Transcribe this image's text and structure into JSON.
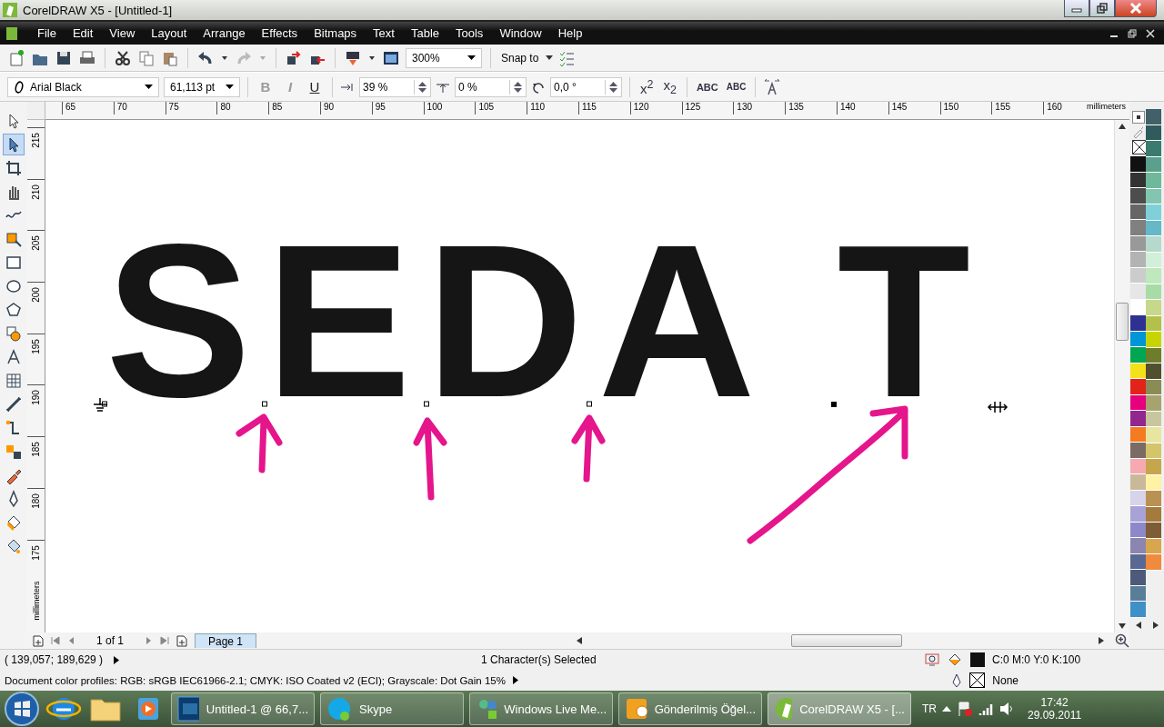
{
  "window": {
    "title": "CorelDRAW X5 - [Untitled-1]"
  },
  "menu": [
    "File",
    "Edit",
    "View",
    "Layout",
    "Arrange",
    "Effects",
    "Bitmaps",
    "Text",
    "Table",
    "Tools",
    "Window",
    "Help"
  ],
  "standard_toolbar": {
    "zoom": "300%",
    "snap": "Snap to"
  },
  "property_bar": {
    "font": "Arial Black",
    "size": "61,113 pt",
    "format_buttons": [
      {
        "label": "B",
        "disabled": true
      },
      {
        "label": "I",
        "disabled": true
      },
      {
        "label": "U",
        "disabled": false
      }
    ],
    "spinners": [
      "39 %",
      "0 %",
      "0,0 °"
    ],
    "script_buttons": [
      "x$^{2}$",
      "x$_{2}$"
    ],
    "case_buttons": [
      "ABC",
      "ABC"
    ]
  },
  "toolbox": [
    {
      "selected": false
    },
    {
      "selected": true
    },
    {
      "selected": false
    },
    {
      "selected": false
    },
    {
      "selected": false
    },
    {
      "selected": false
    },
    {
      "selected": false
    },
    {
      "selected": false
    },
    {
      "selected": false
    },
    {
      "selected": false
    },
    {
      "selected": false
    },
    {
      "selected": false
    },
    {
      "selected": false
    },
    {
      "selected": false
    },
    {
      "selected": false
    },
    {
      "selected": false
    },
    {
      "selected": false
    },
    {
      "selected": false
    },
    {
      "selected": false
    }
  ],
  "ruler_top": {
    "labels": [
      "65",
      "70",
      "75",
      "80",
      "85",
      "90",
      "95",
      "100",
      "105",
      "110",
      "115",
      "120",
      "125",
      "130",
      "135",
      "140",
      "145",
      "150",
      "155",
      "160"
    ],
    "unit": "millimeters"
  },
  "ruler_left": {
    "labels": [
      "215",
      "210",
      "205",
      "200",
      "195",
      "190",
      "185",
      "180",
      "175"
    ],
    "unit": "millimeters"
  },
  "canvas": {
    "text": "SEDA T"
  },
  "palette_columns": [
    [
      {
        "color": "#111111"
      },
      {
        "color": "#333333"
      },
      {
        "color": "#4d4d4d"
      },
      {
        "color": "#666666"
      },
      {
        "color": "#808080"
      },
      {
        "color": "#999999"
      },
      {
        "color": "#b3b3b3"
      },
      {
        "color": "#cccccc"
      },
      {
        "color": "#e6e6e6"
      },
      {
        "color": "#ffffff"
      },
      {
        "color": "#2e3192"
      },
      {
        "color": "#0095d9"
      },
      {
        "color": "#00a651"
      },
      {
        "color": "#f5e11a"
      },
      {
        "color": "#e2231a"
      },
      {
        "color": "#e6007e"
      },
      {
        "color": "#92278f"
      },
      {
        "color": "#f47b20"
      },
      {
        "color": "#7a6c64"
      },
      {
        "color": "#f6a9b0"
      },
      {
        "color": "#c9b99a"
      },
      {
        "color": "#d7d3ea"
      },
      {
        "color": "#a8a3d6"
      },
      {
        "color": "#8d89c9"
      },
      {
        "color": "#8a86b0"
      },
      {
        "color": "#5a6993"
      },
      {
        "color": "#4d5a7a"
      },
      {
        "color": "#5a7e9a"
      },
      {
        "color": "#3e90c6"
      }
    ],
    [
      {
        "color": "#41606a"
      },
      {
        "color": "#2f5b5c"
      },
      {
        "color": "#3b7a6f"
      },
      {
        "color": "#5ba08c"
      },
      {
        "color": "#6eb99b"
      },
      {
        "color": "#82c5b0"
      },
      {
        "color": "#7fd0d8"
      },
      {
        "color": "#64b8c8"
      },
      {
        "color": "#b5d9cc"
      },
      {
        "color": "#d2efd9"
      },
      {
        "color": "#bfe8bf"
      },
      {
        "color": "#a8dca6"
      },
      {
        "color": "#c8d88a"
      },
      {
        "color": "#b3c04a"
      },
      {
        "color": "#c8d400"
      },
      {
        "color": "#6d7d2b"
      },
      {
        "color": "#50502f"
      },
      {
        "color": "#8a8c56"
      },
      {
        "color": "#a6a36f"
      },
      {
        "color": "#c8c69f"
      },
      {
        "color": "#e8e5a3"
      },
      {
        "color": "#d4c46a"
      },
      {
        "color": "#c6a64c"
      },
      {
        "color": "#fff2a5"
      },
      {
        "color": "#b99152"
      },
      {
        "color": "#a47a3d"
      },
      {
        "color": "#7d5d37"
      },
      {
        "color": "#d9a64e"
      },
      {
        "color": "#f08a3c"
      }
    ]
  ],
  "page_nav": {
    "count": "1 of 1",
    "pages": [
      {
        "label": "Page 1",
        "selected": true
      }
    ]
  },
  "status_bar": {
    "coordinates": "( 139,057; 189,629 )",
    "selection": "1 Character(s) Selected",
    "profiles": "Document color profiles: RGB: sRGB IEC61966-2.1; CMYK: ISO Coated v2 (ECI); Grayscale: Dot Gain 15%",
    "fill": {
      "color": "#111111",
      "label": "C:0 M:0 Y:0 K:100"
    },
    "outline": {
      "label": "None"
    }
  },
  "taskbar": {
    "tasks": [
      {
        "label": "Untitled-1 @ 66,7...",
        "kind": "photoshop",
        "selected": false
      },
      {
        "label": "Skype",
        "kind": "skype",
        "selected": false
      },
      {
        "label": "Windows Live Me...",
        "kind": "messenger",
        "selected": false
      },
      {
        "label": "Gönderilmiş Öğel...",
        "kind": "outlook",
        "selected": false
      },
      {
        "label": "CorelDRAW X5 - [...",
        "kind": "corel",
        "selected": true
      }
    ],
    "language": "TR",
    "time": "17:42",
    "date": "29.09.2011"
  }
}
